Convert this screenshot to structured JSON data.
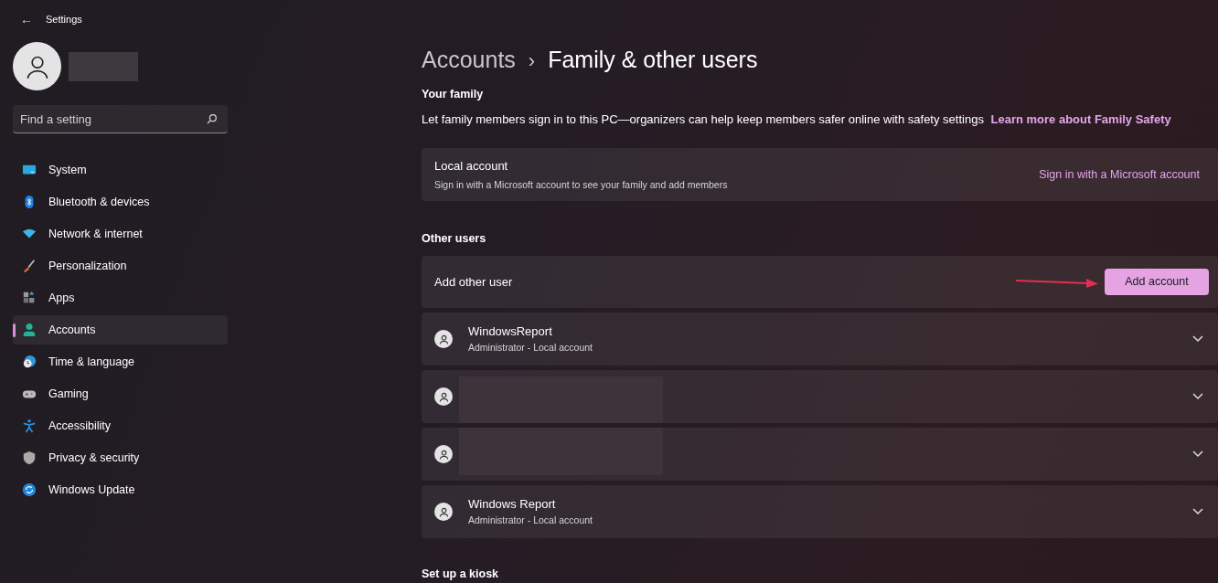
{
  "window": {
    "title": "Settings",
    "back": "←"
  },
  "search": {
    "placeholder": "Find a setting"
  },
  "sidebar": {
    "items": [
      {
        "label": "System",
        "kind": "system",
        "selected": false
      },
      {
        "label": "Bluetooth & devices",
        "kind": "bluetooth",
        "selected": false
      },
      {
        "label": "Network & internet",
        "kind": "network",
        "selected": false
      },
      {
        "label": "Personalization",
        "kind": "brush",
        "selected": false
      },
      {
        "label": "Apps",
        "kind": "apps",
        "selected": false
      },
      {
        "label": "Accounts",
        "kind": "accounts",
        "selected": true
      },
      {
        "label": "Time & language",
        "kind": "time",
        "selected": false
      },
      {
        "label": "Gaming",
        "kind": "gaming",
        "selected": false
      },
      {
        "label": "Accessibility",
        "kind": "accessibility",
        "selected": false
      },
      {
        "label": "Privacy & security",
        "kind": "privacy",
        "selected": false
      },
      {
        "label": "Windows Update",
        "kind": "update",
        "selected": false
      }
    ]
  },
  "breadcrumb": {
    "separator": "›",
    "items": [
      {
        "label": "Accounts",
        "current": false
      },
      {
        "label": "Family & other users",
        "current": true
      }
    ]
  },
  "your_family": {
    "heading": "Your family",
    "description": "Let family members sign in to this PC—organizers can help keep members safer online with safety settings",
    "link": "Learn more about Family Safety",
    "card": {
      "title": "Local account",
      "subtitle": "Sign in with a Microsoft account to see your family and add members",
      "action": "Sign in with a Microsoft account"
    }
  },
  "other_users": {
    "heading": "Other users",
    "add_row": {
      "label": "Add other user",
      "button": "Add account"
    },
    "users": [
      {
        "name": "WindowsReport",
        "role": "Administrator - Local account",
        "expanded": false
      },
      {
        "expanded": false
      },
      {
        "expanded": false
      },
      {
        "name": "Windows Report",
        "role": "Administrator - Local account",
        "expanded": false
      }
    ]
  },
  "kiosk": {
    "heading": "Set up a kiosk"
  }
}
